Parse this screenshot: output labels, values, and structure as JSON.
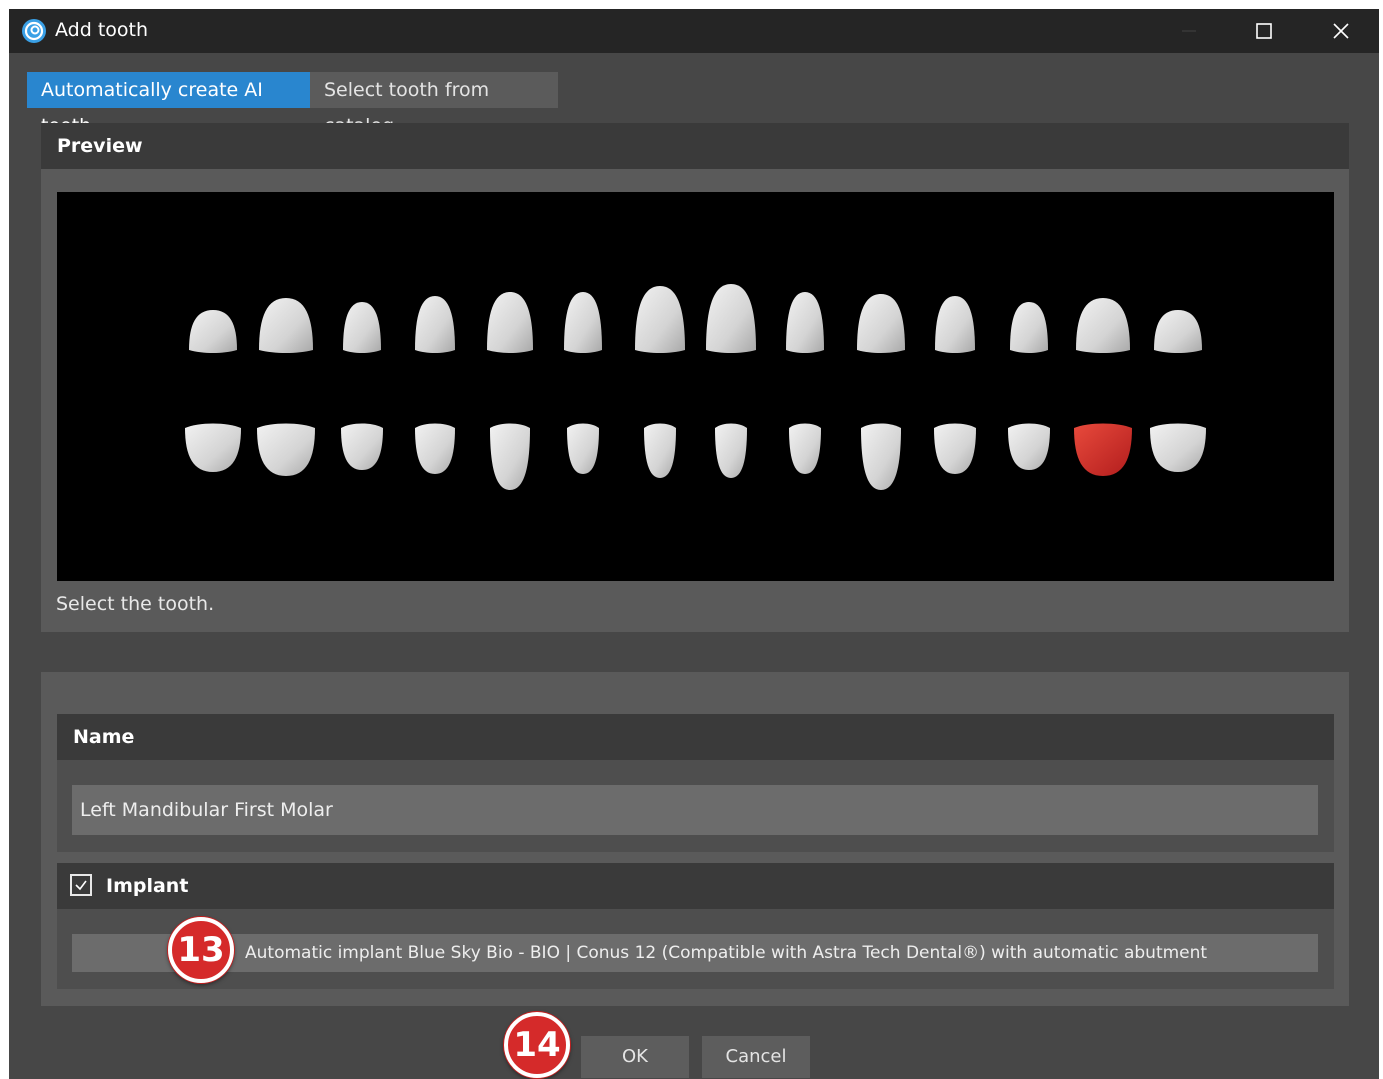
{
  "window": {
    "title": "Add tooth",
    "icon": "app-swirl-icon"
  },
  "title_controls": {
    "minimize": "minimize-icon",
    "maximize": "maximize-icon",
    "close": "close-icon"
  },
  "tabs": [
    {
      "label": "Automatically create AI tooth",
      "active": true
    },
    {
      "label": "Select tooth from catalog",
      "active": false
    }
  ],
  "preview": {
    "header": "Preview",
    "hint": "Select the tooth.",
    "upper_row": {
      "count": 14
    },
    "lower_row": {
      "count": 14,
      "selected_index": 12
    },
    "tooth_color": "#dcdcdc",
    "selected_color": "#d52a2a"
  },
  "name_section": {
    "header": "Name",
    "value": "Left Mandibular First Molar"
  },
  "implant_section": {
    "checked": true,
    "label": "Implant",
    "value": "Automatic implant Blue Sky Bio - BIO | Conus 12 (Compatible with Astra Tech Dental®) with automatic abutment"
  },
  "annotations": {
    "step_13": "13",
    "step_14": "14"
  },
  "buttons": {
    "ok": "OK",
    "cancel": "Cancel"
  },
  "colors": {
    "accent": "#2986cf",
    "badge": "#d52a2a",
    "background": "#474747"
  }
}
